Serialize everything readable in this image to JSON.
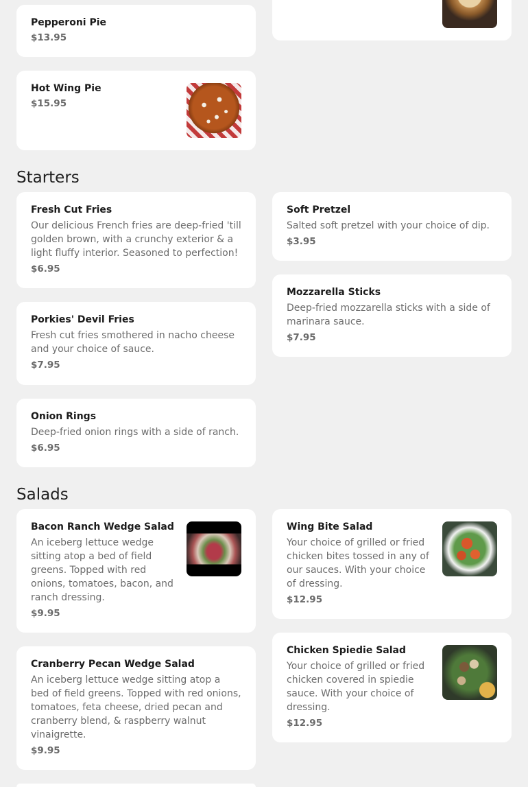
{
  "top_items": [
    {
      "name": "Pepperoni Pie",
      "price": "$13.95"
    },
    {
      "name": "Hot Wing Pie",
      "price": "$15.95"
    }
  ],
  "starters": {
    "title": "Starters",
    "items": [
      {
        "name": "Fresh Cut Fries",
        "desc": "Our delicious French fries are deep-fried 'till golden brown, with a crunchy exterior & a light fluffy interior. Seasoned to perfection!",
        "price": "$6.95"
      },
      {
        "name": "Soft Pretzel",
        "desc": "Salted soft pretzel with your choice of dip.",
        "price": "$3.95"
      },
      {
        "name": "Porkies' Devil Fries",
        "desc": "Fresh cut fries smothered in nacho cheese and your choice of sauce.",
        "price": "$7.95"
      },
      {
        "name": "Mozzarella Sticks",
        "desc": "Deep-fried mozzarella sticks with a side of marinara sauce.",
        "price": "$7.95"
      },
      {
        "name": "Onion Rings",
        "desc": "Deep-fried onion rings with a side of ranch.",
        "price": "$6.95"
      }
    ]
  },
  "salads": {
    "title": "Salads",
    "items": [
      {
        "name": "Bacon Ranch Wedge Salad",
        "desc": "An iceberg lettuce wedge sitting atop a bed of field greens. Topped with red onions, tomatoes, bacon, and ranch dressing.",
        "price": "$9.95"
      },
      {
        "name": "Wing Bite Salad",
        "desc": "Your choice of grilled or fried chicken bites tossed in any of our sauces. With your choice of dressing.",
        "price": "$12.95"
      },
      {
        "name": "Cranberry Pecan Wedge Salad",
        "desc": "An iceberg lettuce wedge sitting atop a bed of field greens. Topped with red onions, tomatoes, feta cheese, dried pecan and cranberry blend, & raspberry walnut vinaigrette.",
        "price": "$9.95"
      },
      {
        "name": "Chicken Spiedie Salad",
        "desc": "Your choice of grilled or fried chicken covered in spiedie sauce. With your choice of dressing.",
        "price": "$12.95"
      }
    ]
  }
}
